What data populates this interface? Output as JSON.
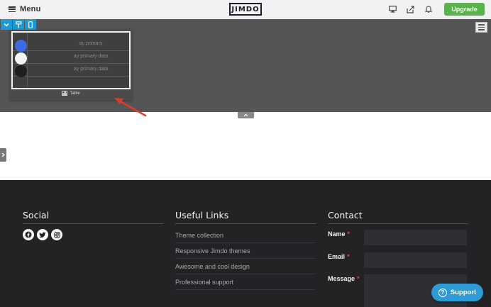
{
  "topbar": {
    "menu_label": "Menu",
    "logo": "JIMDO",
    "upgrade_label": "Upgrade",
    "icons": [
      "desktop-icon",
      "share-icon",
      "bell-icon"
    ]
  },
  "editor": {
    "mini_toolbar_icons": [
      "chevron-down-icon",
      "paint-roller-icon",
      "mobile-icon"
    ],
    "table_widget": {
      "rows": [
        {
          "text": "ay primary",
          "swatch": "#3d6ce0"
        },
        {
          "text": "ay primary data",
          "swatch": "#f4f4f4"
        },
        {
          "text": "ay primary data",
          "swatch": "#1f1f1f"
        }
      ],
      "label": "Table"
    }
  },
  "footer": {
    "social": {
      "title": "Social",
      "icons": [
        "facebook-icon",
        "twitter-icon",
        "instagram-icon"
      ]
    },
    "useful_links": {
      "title": "Useful Links",
      "links": [
        "Theme collection",
        "Responsive Jimdo themes",
        "Awesome and cool design",
        "Professional support"
      ]
    },
    "contact": {
      "title": "Contact",
      "fields": [
        {
          "label": "Name",
          "required": "*"
        },
        {
          "label": "Email",
          "required": "*"
        },
        {
          "label": "Message",
          "required": "*"
        }
      ]
    }
  },
  "support": {
    "label": "Support"
  },
  "colors": {
    "accent": "#1c9ad6",
    "upgrade": "#5bb14c",
    "footer_bg": "#232325",
    "rule": "#3a4ca8",
    "annotation_arrow": "#e03a2e"
  }
}
